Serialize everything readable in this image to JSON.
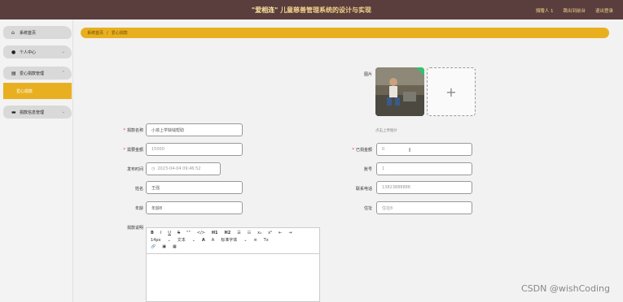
{
  "header": {
    "title_highlight": "\"爱相连\"",
    "title_rest": "儿童慈善管理系统的设计与实现",
    "links": [
      "捐赠人 1",
      "跳出到前台",
      "退出登录"
    ]
  },
  "sidebar": {
    "items": [
      {
        "label": "系统首页",
        "icon": "home-icon"
      },
      {
        "label": "个人中心",
        "icon": "user-icon"
      },
      {
        "label": "爱心捐款管理",
        "icon": "donation-icon"
      },
      {
        "label": "捐款信息管理",
        "icon": "document-icon"
      }
    ],
    "submenu_active": "爱心捐款"
  },
  "breadcrumb": {
    "home": "系统首页",
    "sep": "/",
    "current": "爱心捐款"
  },
  "form": {
    "photo_label": "图片",
    "photo_hint": "点击上传图片",
    "name_label": "捐款名称",
    "name_value": "小孩上学缺钱帮助",
    "target_label": "需要金额",
    "target_value": "15000",
    "raised_label": "已捐金额",
    "raised_value": "0",
    "time_label": "发布时间",
    "time_value": "2023-04-04 09:46:52",
    "account_label": "账号",
    "account_value": "1",
    "person_label": "姓名",
    "person_value": "王强",
    "phone_label": "联系电话",
    "phone_value": "13823888888",
    "age_label": "年龄",
    "age_value": "年龄8",
    "address_label": "住址",
    "address_value": "住址8",
    "desc_label": "捐款说明"
  },
  "editor": {
    "row1": [
      "B",
      "I",
      "U",
      "S",
      "\"\"",
      "</>",
      "H1",
      "H2",
      "☰",
      "☷",
      "x₂",
      "x²",
      "⇤",
      "⇥"
    ],
    "row2": [
      "14px",
      "文本",
      "A",
      "A",
      "标准字体",
      "≡",
      "Tx"
    ],
    "row3": [
      "🔗",
      "▣",
      "▦"
    ]
  },
  "watermark": "CSDN @wishCoding",
  "colors": {
    "header": "#5a3e3e",
    "accent": "#e8b020"
  }
}
